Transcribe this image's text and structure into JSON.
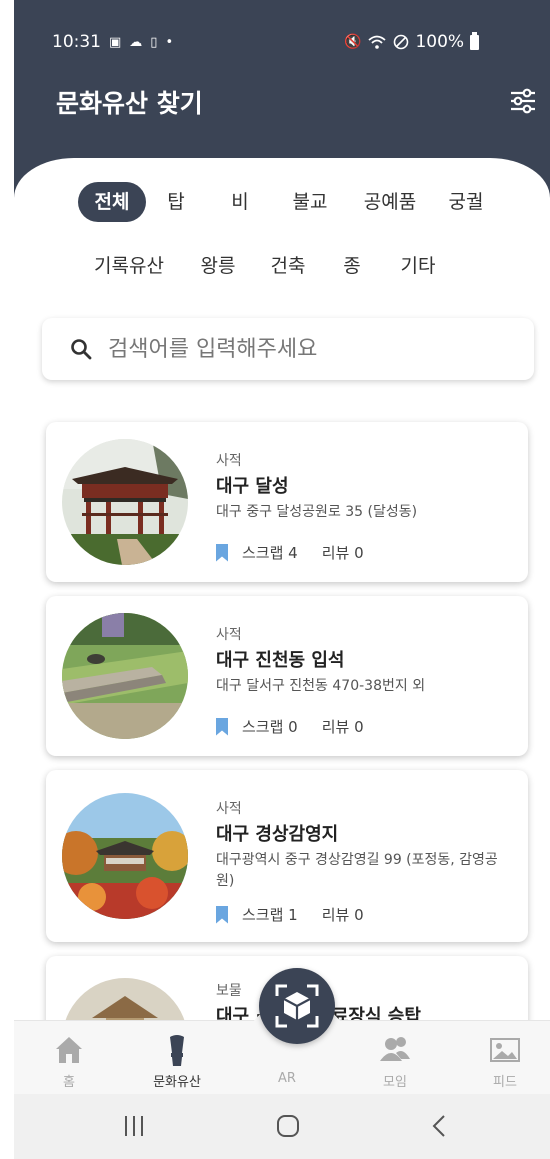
{
  "status_bar": {
    "time": "10:31",
    "battery": "100%"
  },
  "header": {
    "title": "문화유산 찾기"
  },
  "categories": {
    "row1": [
      "전체",
      "탑",
      "비",
      "불교",
      "공예품",
      "궁궐"
    ],
    "row2": [
      "기록유산",
      "왕릉",
      "건축",
      "종",
      "기타"
    ],
    "active": "전체"
  },
  "search": {
    "placeholder": "검색어를 입력해주세요"
  },
  "items": [
    {
      "category": "사적",
      "name": "대구 달성",
      "address": "대구 중구 달성공원로 35 (달성동)",
      "scrap": "스크랩 4",
      "review": "리뷰 0"
    },
    {
      "category": "사적",
      "name": "대구 진천동 입석",
      "address": "대구 달서구 진천동 470-38번지 외",
      "scrap": "스크랩 0",
      "review": "리뷰 0"
    },
    {
      "category": "사적",
      "name": "대구 경상감영지",
      "address": "대구광역시 중구 경상감영길 99 (포정동, 감영공원)",
      "scrap": "스크랩 1",
      "review": "리뷰 0"
    },
    {
      "category": "보물",
      "name": "대구 ···영화 유료장식 승탑"
    }
  ],
  "bottom_nav": [
    {
      "label": "홈",
      "icon": "home-icon"
    },
    {
      "label": "문화유산",
      "icon": "heritage-icon"
    },
    {
      "label": "AR",
      "icon": "ar-cube-icon"
    },
    {
      "label": "모임",
      "icon": "group-icon"
    },
    {
      "label": "피드",
      "icon": "image-icon"
    }
  ],
  "colors": {
    "primary": "#3b4455",
    "bookmark": "#6aa6e0"
  }
}
